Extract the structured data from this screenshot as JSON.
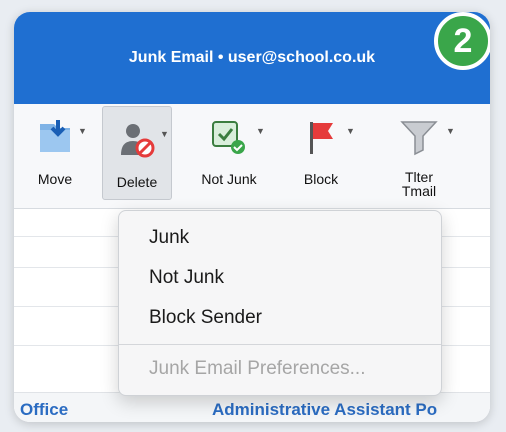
{
  "window": {
    "title": "Junk Email • user@school.co.uk"
  },
  "badge": {
    "number": "2",
    "color": "#3aa64a"
  },
  "colors": {
    "accent": "#1f6fd1",
    "link": "#2b6cc2",
    "flag": "#e53b3b"
  },
  "ribbon": {
    "buttons": [
      {
        "label": "Move",
        "icon": "move-folder-icon"
      },
      {
        "label": "Delete",
        "icon": "delete-person-icon"
      },
      {
        "label": "Not Junk",
        "icon": "not-junk-icon"
      },
      {
        "label": "Block",
        "icon": "red-flag-icon"
      },
      {
        "label_line1": "Tlter",
        "label_line2": "Tmail",
        "icon": "filter-funnel-icon"
      }
    ]
  },
  "menu": {
    "items": [
      "Junk",
      "Not Junk",
      "Block Sender"
    ],
    "disabled_item": "Junk Email Preferences..."
  },
  "list": {
    "office_text": "Office",
    "admin_text": "Administrative Assistant Po"
  }
}
